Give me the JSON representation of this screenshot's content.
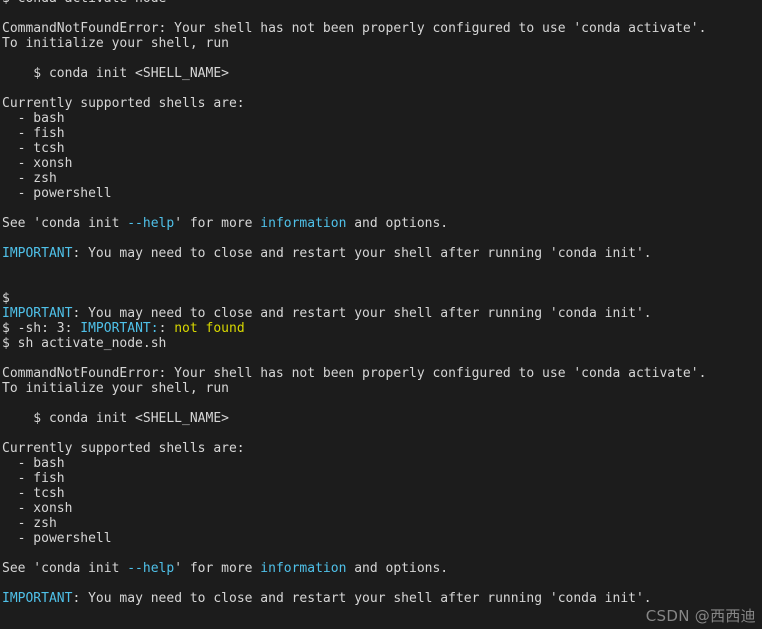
{
  "terminal": {
    "background_color": "#1c1c1c",
    "foreground_color": "#d6d6d6",
    "accent_cyan": "#4fc1e9",
    "accent_yellow": "#d8d800",
    "font_size_px": 13,
    "line_height_px": 15
  },
  "watermark": {
    "text": "CSDN @西西迪",
    "color": "#8c8c8c"
  },
  "lines": [
    {
      "id": "l00",
      "segments": [
        {
          "text": "$ conda activate node",
          "color": "default"
        }
      ]
    },
    {
      "id": "l01",
      "segments": [
        {
          "text": "",
          "color": "default"
        }
      ]
    },
    {
      "id": "l02",
      "segments": [
        {
          "text": "CommandNotFoundError: Your shell has not been properly configured to use 'conda activate'.",
          "color": "default"
        }
      ]
    },
    {
      "id": "l03",
      "segments": [
        {
          "text": "To initialize your shell, run",
          "color": "default"
        }
      ]
    },
    {
      "id": "l04",
      "segments": [
        {
          "text": "",
          "color": "default"
        }
      ]
    },
    {
      "id": "l05",
      "segments": [
        {
          "text": "    $ conda init <SHELL_NAME>",
          "color": "default"
        }
      ]
    },
    {
      "id": "l06",
      "segments": [
        {
          "text": "",
          "color": "default"
        }
      ]
    },
    {
      "id": "l07",
      "segments": [
        {
          "text": "Currently supported shells are:",
          "color": "default"
        }
      ]
    },
    {
      "id": "l08",
      "segments": [
        {
          "text": "  - bash",
          "color": "default"
        }
      ]
    },
    {
      "id": "l09",
      "segments": [
        {
          "text": "  - fish",
          "color": "default"
        }
      ]
    },
    {
      "id": "l10",
      "segments": [
        {
          "text": "  - tcsh",
          "color": "default"
        }
      ]
    },
    {
      "id": "l11",
      "segments": [
        {
          "text": "  - xonsh",
          "color": "default"
        }
      ]
    },
    {
      "id": "l12",
      "segments": [
        {
          "text": "  - zsh",
          "color": "default"
        }
      ]
    },
    {
      "id": "l13",
      "segments": [
        {
          "text": "  - powershell",
          "color": "default"
        }
      ]
    },
    {
      "id": "l14",
      "segments": [
        {
          "text": "",
          "color": "default"
        }
      ]
    },
    {
      "id": "l15",
      "segments": [
        {
          "text": "See 'conda init ",
          "color": "default"
        },
        {
          "text": "--help",
          "color": "cyan"
        },
        {
          "text": "' for more ",
          "color": "default"
        },
        {
          "text": "information",
          "color": "cyan"
        },
        {
          "text": " and options.",
          "color": "default"
        }
      ]
    },
    {
      "id": "l16",
      "segments": [
        {
          "text": "",
          "color": "default"
        }
      ]
    },
    {
      "id": "l17",
      "segments": [
        {
          "text": "IMPORTANT",
          "color": "cyan"
        },
        {
          "text": ": You may need to close and restart your shell after running 'conda init'.",
          "color": "default"
        }
      ]
    },
    {
      "id": "l18",
      "segments": [
        {
          "text": "",
          "color": "default"
        }
      ]
    },
    {
      "id": "l19",
      "segments": [
        {
          "text": "",
          "color": "default"
        }
      ]
    },
    {
      "id": "l20",
      "segments": [
        {
          "text": "$",
          "color": "default"
        }
      ]
    },
    {
      "id": "l21",
      "segments": [
        {
          "text": "IMPORTANT",
          "color": "cyan"
        },
        {
          "text": ": You may need to close and restart your shell after running 'conda init'.",
          "color": "default"
        }
      ]
    },
    {
      "id": "l22",
      "segments": [
        {
          "text": "$ -sh: 3: ",
          "color": "default"
        },
        {
          "text": "IMPORTANT:",
          "color": "cyan"
        },
        {
          "text": ": ",
          "color": "default"
        },
        {
          "text": "not found",
          "color": "yellow"
        }
      ]
    },
    {
      "id": "l23",
      "segments": [
        {
          "text": "$ sh activate_node.sh",
          "color": "default"
        }
      ]
    },
    {
      "id": "l24",
      "segments": [
        {
          "text": "",
          "color": "default"
        }
      ]
    },
    {
      "id": "l25",
      "segments": [
        {
          "text": "CommandNotFoundError: Your shell has not been properly configured to use 'conda activate'.",
          "color": "default"
        }
      ]
    },
    {
      "id": "l26",
      "segments": [
        {
          "text": "To initialize your shell, run",
          "color": "default"
        }
      ]
    },
    {
      "id": "l27",
      "segments": [
        {
          "text": "",
          "color": "default"
        }
      ]
    },
    {
      "id": "l28",
      "segments": [
        {
          "text": "    $ conda init <SHELL_NAME>",
          "color": "default"
        }
      ]
    },
    {
      "id": "l29",
      "segments": [
        {
          "text": "",
          "color": "default"
        }
      ]
    },
    {
      "id": "l30",
      "segments": [
        {
          "text": "Currently supported shells are:",
          "color": "default"
        }
      ]
    },
    {
      "id": "l31",
      "segments": [
        {
          "text": "  - bash",
          "color": "default"
        }
      ]
    },
    {
      "id": "l32",
      "segments": [
        {
          "text": "  - fish",
          "color": "default"
        }
      ]
    },
    {
      "id": "l33",
      "segments": [
        {
          "text": "  - tcsh",
          "color": "default"
        }
      ]
    },
    {
      "id": "l34",
      "segments": [
        {
          "text": "  - xonsh",
          "color": "default"
        }
      ]
    },
    {
      "id": "l35",
      "segments": [
        {
          "text": "  - zsh",
          "color": "default"
        }
      ]
    },
    {
      "id": "l36",
      "segments": [
        {
          "text": "  - powershell",
          "color": "default"
        }
      ]
    },
    {
      "id": "l37",
      "segments": [
        {
          "text": "",
          "color": "default"
        }
      ]
    },
    {
      "id": "l38",
      "segments": [
        {
          "text": "See 'conda init ",
          "color": "default"
        },
        {
          "text": "--help",
          "color": "cyan"
        },
        {
          "text": "' for more ",
          "color": "default"
        },
        {
          "text": "information",
          "color": "cyan"
        },
        {
          "text": " and options.",
          "color": "default"
        }
      ]
    },
    {
      "id": "l39",
      "segments": [
        {
          "text": "",
          "color": "default"
        }
      ]
    },
    {
      "id": "l40",
      "segments": [
        {
          "text": "IMPORTANT",
          "color": "cyan"
        },
        {
          "text": ": You may need to close and restart your shell after running 'conda init'.",
          "color": "default"
        }
      ]
    }
  ]
}
